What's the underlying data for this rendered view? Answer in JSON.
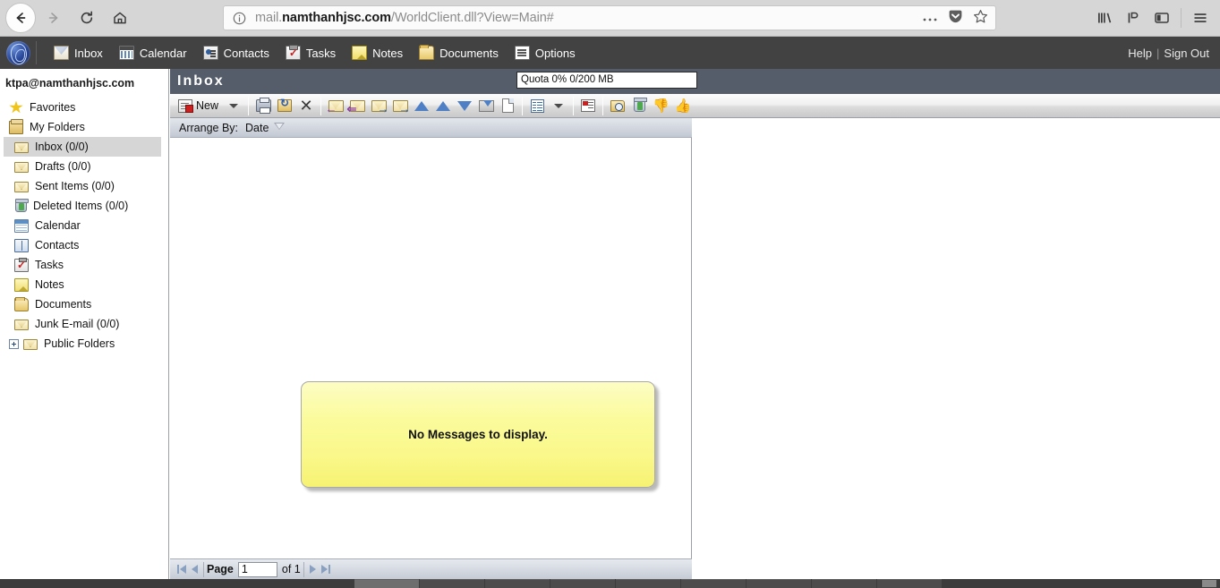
{
  "browser": {
    "url_prefix": "mail.",
    "url_host": "namthanhjsc.com",
    "url_path": "/WorldClient.dll?View=Main#",
    "back_icon": "back-arrow-icon",
    "forward_icon": "forward-arrow-icon",
    "reload_icon": "reload-icon",
    "home_icon": "home-icon",
    "info_icon": "page-info-icon",
    "page_actions_icon": "ellipsis-icon",
    "pocket_icon": "pocket-icon",
    "bookmark_icon": "star-icon",
    "library_icon": "library-icon",
    "sync_icon": "sync-icon",
    "sidebar_icon": "sidebar-icon",
    "menu_icon": "hamburger-menu-icon"
  },
  "app_nav": {
    "logo": "worldclient-globe-logo",
    "items": [
      {
        "label": "Inbox",
        "icon": "inbox-icon"
      },
      {
        "label": "Calendar",
        "icon": "calendar-icon"
      },
      {
        "label": "Contacts",
        "icon": "contacts-icon"
      },
      {
        "label": "Tasks",
        "icon": "tasks-icon"
      },
      {
        "label": "Notes",
        "icon": "notes-icon"
      },
      {
        "label": "Documents",
        "icon": "documents-icon"
      },
      {
        "label": "Options",
        "icon": "options-icon"
      }
    ],
    "help_label": "Help",
    "separator": "|",
    "signout_label": "Sign Out"
  },
  "sidebar": {
    "account": "ktpa@namthanhjsc.com",
    "items": [
      {
        "label": "Favorites",
        "icon": "star-icon"
      },
      {
        "label": "My Folders",
        "icon": "folders-icon"
      },
      {
        "label": "Inbox (0/0)",
        "icon": "envelope-icon"
      },
      {
        "label": "Drafts (0/0)",
        "icon": "envelope-icon"
      },
      {
        "label": "Sent Items (0/0)",
        "icon": "envelope-icon"
      },
      {
        "label": "Deleted Items (0/0)",
        "icon": "trash-icon"
      },
      {
        "label": "Calendar",
        "icon": "calendar-icon"
      },
      {
        "label": "Contacts",
        "icon": "contacts-book-icon"
      },
      {
        "label": "Tasks",
        "icon": "tasks-clipboard-icon"
      },
      {
        "label": "Notes",
        "icon": "note-icon"
      },
      {
        "label": "Documents",
        "icon": "documents-folder-icon"
      },
      {
        "label": "Junk E-mail (0/0)",
        "icon": "envelope-icon"
      },
      {
        "label": "Public Folders",
        "icon": "envelope-icon",
        "expander": "plus-expander-icon"
      }
    ]
  },
  "main": {
    "title": "Inbox",
    "quota": "Quota 0% 0/200 MB",
    "toolbar": {
      "new_label": "New",
      "new_icon": "new-message-icon",
      "new_dropdown_icon": "chevron-down-icon",
      "buttons": [
        {
          "name": "print-button",
          "icon": "printer-icon"
        },
        {
          "name": "move-to-folder-button",
          "icon": "move-to-folder-icon"
        },
        {
          "name": "delete-button",
          "icon": "close-x-icon"
        },
        {
          "name": "reply-button",
          "icon": "reply-icon"
        },
        {
          "name": "reply-all-button",
          "icon": "reply-all-icon"
        },
        {
          "name": "forward-button",
          "icon": "forward-mail-icon"
        },
        {
          "name": "forward-as-attachment-button",
          "icon": "forward-attachment-icon"
        },
        {
          "name": "move-up-button",
          "icon": "arrow-up-icon"
        },
        {
          "name": "previous-message-button",
          "icon": "arrow-up-icon"
        },
        {
          "name": "next-message-button",
          "icon": "arrow-down-icon"
        },
        {
          "name": "mark-unread-button",
          "icon": "mark-unread-icon"
        },
        {
          "name": "blank-message-button",
          "icon": "blank-page-icon"
        },
        {
          "name": "preview-pane-button",
          "icon": "preview-pane-icon"
        },
        {
          "name": "preview-pane-dropdown",
          "icon": "chevron-down-icon"
        },
        {
          "name": "view-message-button",
          "icon": "view-message-icon"
        },
        {
          "name": "search-folder-button",
          "icon": "search-folder-icon"
        },
        {
          "name": "empty-trash-button",
          "icon": "trash-icon"
        },
        {
          "name": "mark-spam-button",
          "icon": "thumbs-down-icon"
        },
        {
          "name": "mark-not-spam-button",
          "icon": "thumbs-up-icon"
        }
      ]
    },
    "arrange": {
      "label": "Arrange By:",
      "value": "Date",
      "sort_icon": "sort-descending-icon"
    },
    "empty_message": "No Messages to display.",
    "pager": {
      "first_icon": "first-page-icon",
      "prev_icon": "previous-page-icon",
      "page_label": "Page",
      "page_value": "1",
      "of_label": "of 1",
      "next_icon": "next-page-icon",
      "last_icon": "last-page-icon"
    }
  },
  "colors": {
    "app_nav_bg": "#424242",
    "inbox_header_bg": "#555d6b",
    "empty_box_bg": "#faf88a",
    "browser_chrome_bg": "#d6d6d6",
    "selected_folder_bg": "#d6d6d6"
  }
}
